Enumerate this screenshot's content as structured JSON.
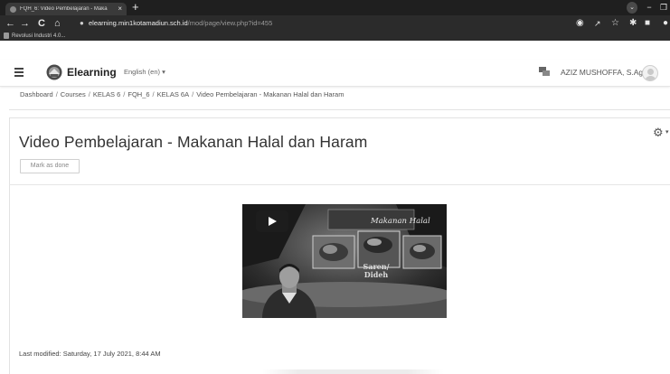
{
  "browser": {
    "tab_title": "FQH_6: Video Pembelajaran - Maka",
    "tab_close": "×",
    "new_tab": "+",
    "window_controls": {
      "dropdown": "⌄",
      "minimize": "−",
      "restore": "❐"
    },
    "nav": {
      "back": "←",
      "forward": "→",
      "reload": "C",
      "home": "⌂"
    },
    "url_host": "elearning.min1kotamadiun.sch.id",
    "url_path": "/mod/page/view.php?id=455",
    "bookmark_label": "Revolusi Industri 4.0..."
  },
  "navbar": {
    "brand": "Elearning",
    "language": "English (en) ▾",
    "user_name": "AZIZ MUSHOFFA, S.Ag"
  },
  "breadcrumb": [
    "Dashboard",
    "Courses",
    "KELAS 6",
    "FQH_6",
    "KELAS 6A",
    "Video Pembelajaran - Makanan Halal dan Haram"
  ],
  "breadcrumb_separator": "/",
  "page": {
    "title": "Video Pembelajaran - Makanan Halal dan Haram",
    "mark_done_label": "Mark as done",
    "gear_caret": "▾",
    "last_modified": "Last modified: Saturday, 17 July 2021, 8:44 AM"
  },
  "video": {
    "overlay_title": "Makanan Halal",
    "caption_line1": "Saren/",
    "caption_line2": "Dideh"
  }
}
